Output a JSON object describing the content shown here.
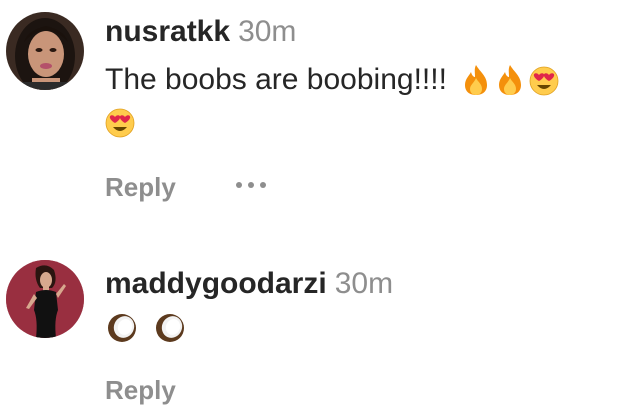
{
  "comments": [
    {
      "username": "nusratkk",
      "time": "30m",
      "text": "The boobs are boobing!!!!",
      "emojis_line1": [
        "fire-emoji",
        "fire-emoji",
        "heart-eyes-emoji"
      ],
      "emojis_line2": [
        "heart-eyes-emoji"
      ],
      "reply_label": "Reply"
    },
    {
      "username": "maddygoodarzi",
      "time": "30m",
      "emojis_line1": [
        "coconut-emoji",
        "coconut-emoji"
      ],
      "reply_label": "Reply"
    }
  ],
  "colors": {
    "text": "#262626",
    "secondary": "#8e8e8e"
  }
}
